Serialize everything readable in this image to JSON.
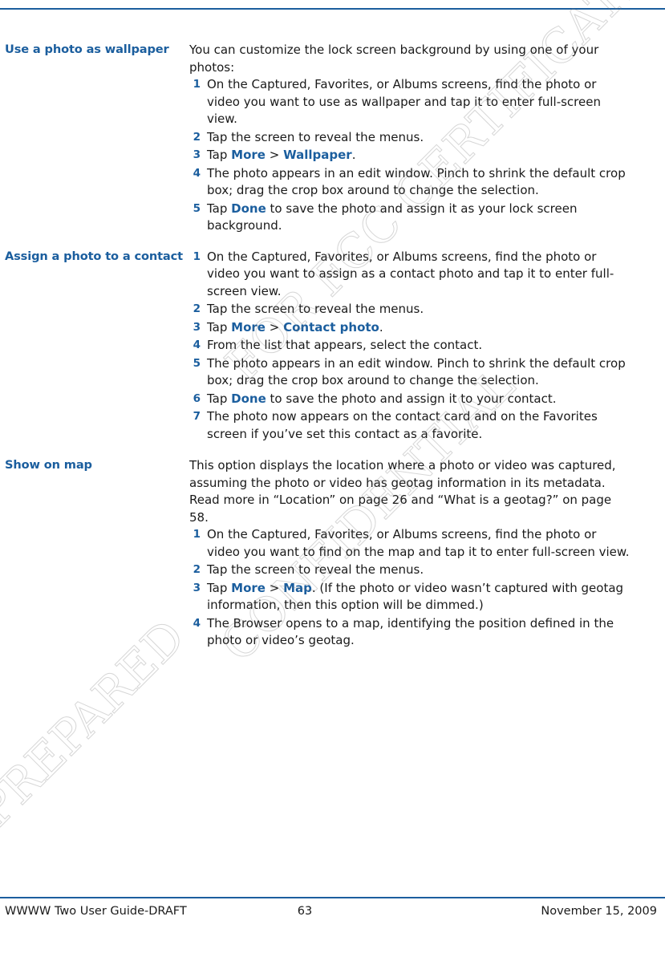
{
  "document": {
    "footer": {
      "left": "WWWW Two User Guide-DRAFT",
      "page_number": "63",
      "date": "November 15, 2009"
    },
    "watermarks": [
      "FOR FCC CERTIFICATION",
      "PREPARED",
      "CONFIDENTIAL"
    ]
  },
  "sections": [
    {
      "heading": "Use a photo as wallpaper",
      "intro": "You can customize the lock screen background by using one of your photos:",
      "steps": [
        {
          "num": "1",
          "parts": [
            {
              "t": "On the Captured, Favorites, or Albums screens, find the photo or video you want to use as wallpaper and tap it to enter full-screen view."
            }
          ]
        },
        {
          "num": "2",
          "parts": [
            {
              "t": "Tap the screen to reveal the menus."
            }
          ]
        },
        {
          "num": "3",
          "parts": [
            {
              "t": "Tap "
            },
            {
              "t": "More",
              "kw": true
            },
            {
              "t": " > "
            },
            {
              "t": "Wallpaper",
              "kw": true
            },
            {
              "t": "."
            }
          ]
        },
        {
          "num": "4",
          "parts": [
            {
              "t": "The photo appears in an edit window. Pinch to shrink the default crop box; drag the crop box around to change the selection."
            }
          ]
        },
        {
          "num": "5",
          "parts": [
            {
              "t": "Tap "
            },
            {
              "t": "Done",
              "kw": true
            },
            {
              "t": " to save the photo and assign it as your lock screen background."
            }
          ]
        }
      ]
    },
    {
      "heading": "Assign a photo to a contact",
      "intro": "",
      "steps": [
        {
          "num": "1",
          "parts": [
            {
              "t": "On the Captured, Favorites, or Albums screens, find the photo or video you want to assign as a contact photo and tap it to enter full-screen view."
            }
          ]
        },
        {
          "num": "2",
          "parts": [
            {
              "t": "Tap the screen to reveal the menus."
            }
          ]
        },
        {
          "num": "3",
          "parts": [
            {
              "t": "Tap "
            },
            {
              "t": "More",
              "kw": true
            },
            {
              "t": " > "
            },
            {
              "t": "Contact photo",
              "kw": true
            },
            {
              "t": "."
            }
          ]
        },
        {
          "num": "4",
          "parts": [
            {
              "t": "From the list that appears, select the contact."
            }
          ]
        },
        {
          "num": "5",
          "parts": [
            {
              "t": "The photo appears in an edit window. Pinch to shrink the default crop box; drag the crop box around to change the selection."
            }
          ]
        },
        {
          "num": "6",
          "parts": [
            {
              "t": "Tap "
            },
            {
              "t": "Done",
              "kw": true
            },
            {
              "t": " to save the photo and assign it to your contact."
            }
          ]
        },
        {
          "num": "7",
          "parts": [
            {
              "t": "The photo now appears on the contact card and on the Favorites screen if you’ve set this contact as a favorite."
            }
          ]
        }
      ]
    },
    {
      "heading": "Show on map",
      "intro": "This option displays the location where a photo or video was captured, assuming the photo or video has geotag information in its metadata. Read more in “Location” on page 26 and “What is a geotag?” on page 58.",
      "steps": [
        {
          "num": "1",
          "parts": [
            {
              "t": "On the Captured, Favorites, or Albums screens, find the photo or video you want to find on the map and tap it to enter full-screen view."
            }
          ]
        },
        {
          "num": "2",
          "parts": [
            {
              "t": "Tap the screen to reveal the menus."
            }
          ]
        },
        {
          "num": "3",
          "parts": [
            {
              "t": "Tap "
            },
            {
              "t": "More",
              "kw": true
            },
            {
              "t": " > "
            },
            {
              "t": "Map",
              "kw": true
            },
            {
              "t": ". (If the photo or video wasn’t captured with geotag information, then this option will be dimmed.)"
            }
          ]
        },
        {
          "num": "4",
          "parts": [
            {
              "t": "The Browser opens to a map, identifying the position defined in the photo or video’s geotag."
            }
          ]
        }
      ]
    }
  ]
}
